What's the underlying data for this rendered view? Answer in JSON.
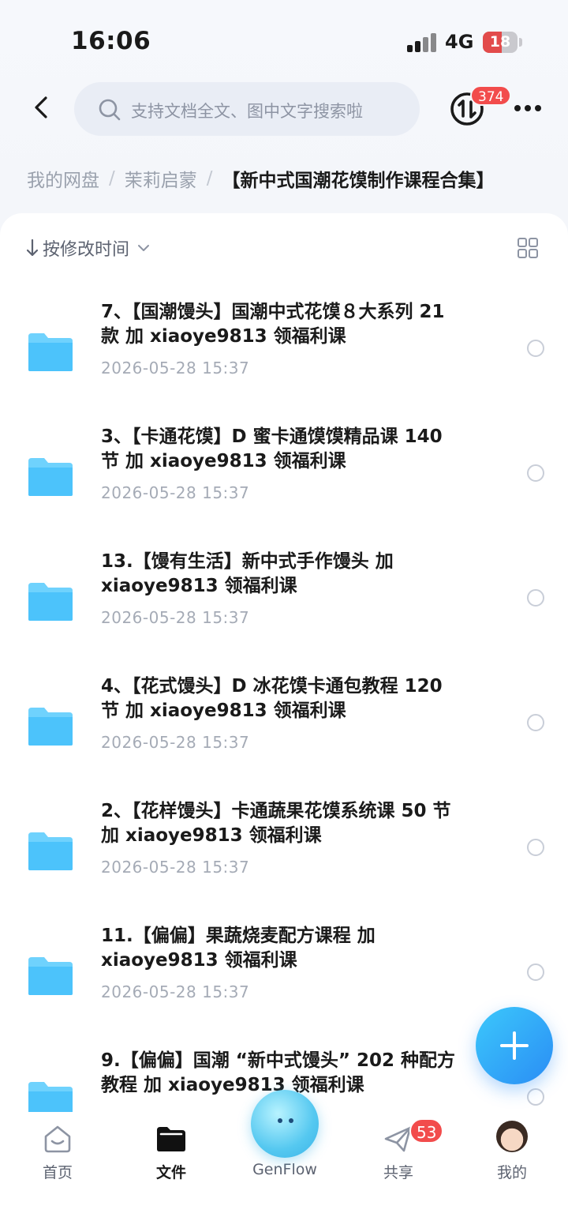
{
  "status_bar": {
    "time": "16:06",
    "network": "4G",
    "battery": "18"
  },
  "header": {
    "search_placeholder": "支持文档全文、图中文字搜索啦",
    "transfer_badge": "374"
  },
  "breadcrumb": {
    "items": [
      "我的网盘",
      "茉莉启蒙"
    ],
    "separator": "/",
    "current": "【新中式国潮花馍制作课程合集】"
  },
  "toolbar": {
    "sort_label": "按修改时间"
  },
  "files": [
    {
      "name_line1": "7、【国潮馒头】国潮中式花馍８大系列 21",
      "name_line2": "款 加 xiaoye9813 领福利课",
      "date": "2026-05-28 15:37"
    },
    {
      "name_line1": "3、【卡通花馍】D 蜜卡通馍馍精品课 140",
      "name_line2": "节 加 xiaoye9813 领福利课",
      "date": "2026-05-28 15:37"
    },
    {
      "name_line1": "13.【馒有生活】新中式手作馒头 加",
      "name_line2": " xiaoye9813 领福利课",
      "date": "2026-05-28 15:37"
    },
    {
      "name_line1": "4、【花式馒头】D 冰花馍卡通包教程 120",
      "name_line2": "节 加 xiaoye9813 领福利课",
      "date": "2026-05-28 15:37"
    },
    {
      "name_line1": "2、【花样馒头】卡通蔬果花馍系统课 50 节",
      "name_line2": "加 xiaoye9813 领福利课",
      "date": "2026-05-28 15:37"
    },
    {
      "name_line1": "11.【偏偏】果蔬烧麦配方课程 加",
      "name_line2": " xiaoye9813 领福利课",
      "date": "2026-05-28 15:37"
    },
    {
      "name_line1": "9.【偏偏】国潮 “新中式馒头” 202 种配方",
      "name_line2": "教程 加 xiaoye9813 领福利课",
      "date": ""
    }
  ],
  "bottom_nav": {
    "items": [
      {
        "label": "首页",
        "icon": "home-icon"
      },
      {
        "label": "文件",
        "icon": "folder-icon",
        "active": true
      },
      {
        "label": "GenFlow",
        "icon": "genflow-orb"
      },
      {
        "label": "共享",
        "icon": "paper-plane-icon"
      },
      {
        "label": "我的",
        "icon": "avatar"
      }
    ],
    "share_badge": "53"
  },
  "colors": {
    "accent": "#2a8df5",
    "badge": "#f24c4c",
    "folder": "#4cc3fb"
  }
}
